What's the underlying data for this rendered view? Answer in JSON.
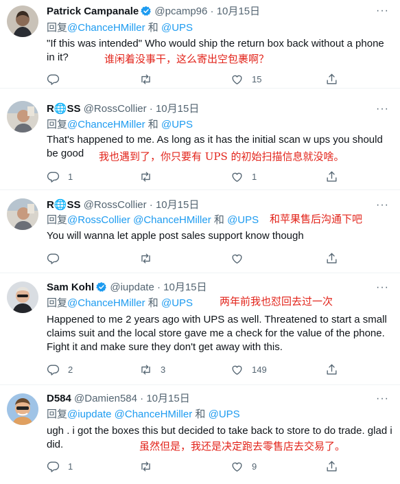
{
  "ui": {
    "reply_prefix": "回复",
    "and": "和",
    "dot": "·",
    "more_glyph": "···"
  },
  "colors": {
    "mention": "#1d9bf0",
    "muted": "#536471",
    "annotation": "#e2231a",
    "verified": "#1d9bf0"
  },
  "icons": [
    "reply-icon",
    "retweet-icon",
    "like-icon",
    "share-icon",
    "verified-badge-icon",
    "more-icon"
  ],
  "tweets": [
    {
      "name": "Patrick Campanale",
      "verified": true,
      "handle": "@pcamp96",
      "date": "10月15日",
      "mentions": [
        "@ChanceHMiller",
        "@UPS"
      ],
      "text": "\"If this was intended\" Who would ship the return box back without a phone in it?",
      "annotation": "谁闲着没事干，这么寄出空包裹啊？",
      "reply_count": "",
      "retweet_count": "",
      "like_count": "15"
    },
    {
      "name": "R🌐SS",
      "verified": false,
      "handle": "@RossCollier",
      "date": "10月15日",
      "mentions": [
        "@ChanceHMiller",
        "@UPS"
      ],
      "text": "That's happened to me. As long as it has the initial scan w ups you should be good",
      "annotation": "我也遇到了，你只要有 UPS 的初始扫描信息就没啥。",
      "reply_count": "1",
      "retweet_count": "",
      "like_count": "1"
    },
    {
      "name": "R🌐SS",
      "verified": false,
      "handle": "@RossCollier",
      "date": "10月15日",
      "mentions": [
        "@RossCollier",
        "@ChanceHMiller",
        "@UPS"
      ],
      "text": "You will wanna let apple post sales support know though",
      "annotation": "和苹果售后沟通下吧",
      "reply_count": "",
      "retweet_count": "",
      "like_count": ""
    },
    {
      "name": "Sam Kohl",
      "verified": true,
      "handle": "@iupdate",
      "date": "10月15日",
      "mentions": [
        "@ChanceHMiller",
        "@UPS"
      ],
      "text": "Happened to me 2 years ago with UPS as well. Threatened to start a small claims suit and the local store gave me a check for the value of the phone. Fight it and make sure they don't get away with this.",
      "annotation": "两年前我也怼回去过一次",
      "reply_count": "2",
      "retweet_count": "3",
      "like_count": "149"
    },
    {
      "name": "D584",
      "verified": false,
      "handle": "@Damien584",
      "date": "10月15日",
      "mentions": [
        "@iupdate",
        "@ChanceHMiller",
        "@UPS"
      ],
      "text": "ugh . i got the boxes this but decided to take back to store to do trade. glad i did.",
      "annotation": "虽然但是，我还是决定跑去零售店去交易了。",
      "reply_count": "1",
      "retweet_count": "",
      "like_count": "9"
    }
  ]
}
